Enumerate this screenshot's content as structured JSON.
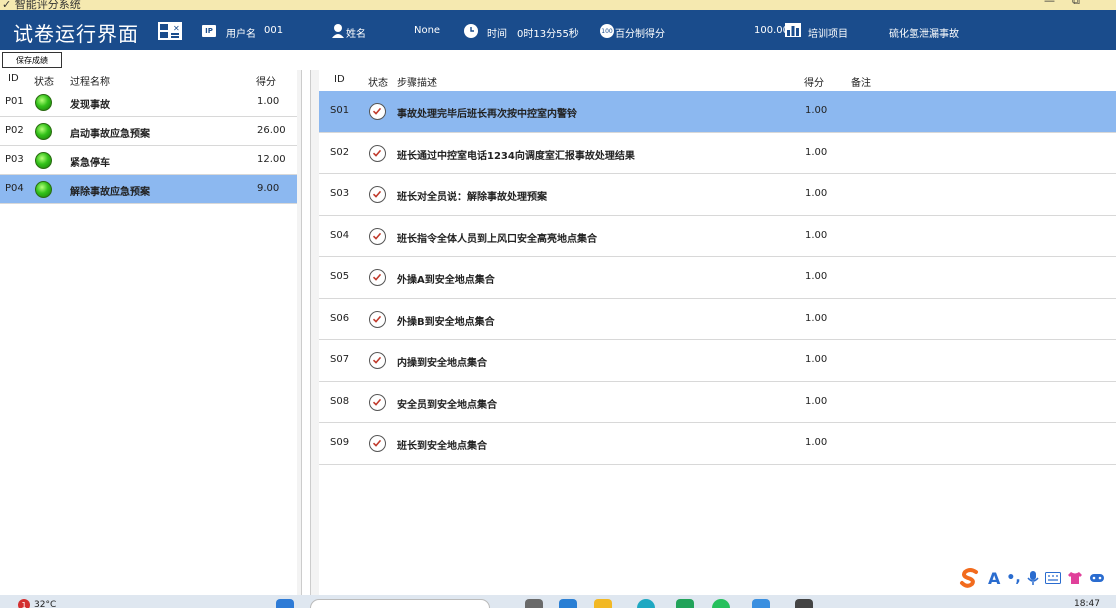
{
  "window": {
    "title": "智能评分系统"
  },
  "header": {
    "title": "试卷运行界面",
    "username_label": "用户名",
    "username_value": "001",
    "name_label": "姓名",
    "name_value": "None",
    "time_label": "时间",
    "time_value": "0时13分55秒",
    "score_label": "百分制得分",
    "score_value": "100.00",
    "project_label": "培训项目",
    "project_value": "硫化氢泄漏事故",
    "ip_icon_text": "IP",
    "score_icon_text": "100"
  },
  "toolbar": {
    "save_label": "保存成绩"
  },
  "left": {
    "columns": [
      "ID",
      "状态",
      "过程名称",
      "得分"
    ],
    "rows": [
      {
        "id": "P01",
        "name": "发现事故",
        "score": "1.00"
      },
      {
        "id": "P02",
        "name": "启动事故应急预案",
        "score": "26.00"
      },
      {
        "id": "P03",
        "name": "紧急停车",
        "score": "12.00"
      },
      {
        "id": "P04",
        "name": "解除事故应急预案",
        "score": "9.00"
      }
    ],
    "selected_index": 3
  },
  "right": {
    "columns": [
      "ID",
      "状态",
      "步骤描述",
      "得分",
      "备注"
    ],
    "rows": [
      {
        "id": "S01",
        "desc": "事故处理完毕后班长再次按中控室内警铃",
        "score": "1.00"
      },
      {
        "id": "S02",
        "desc": "班长通过中控室电话1234向调度室汇报事故处理结果",
        "score": "1.00"
      },
      {
        "id": "S03",
        "desc": "班长对全员说：解除事故处理预案",
        "score": "1.00"
      },
      {
        "id": "S04",
        "desc": "班长指令全体人员到上风口安全高亮地点集合",
        "score": "1.00"
      },
      {
        "id": "S05",
        "desc": "外操A到安全地点集合",
        "score": "1.00"
      },
      {
        "id": "S06",
        "desc": "外操B到安全地点集合",
        "score": "1.00"
      },
      {
        "id": "S07",
        "desc": "内操到安全地点集合",
        "score": "1.00"
      },
      {
        "id": "S08",
        "desc": "安全员到安全地点集合",
        "score": "1.00"
      },
      {
        "id": "S09",
        "desc": "班长到安全地点集合",
        "score": "1.00"
      }
    ],
    "selected_index": 0
  },
  "ime": {
    "mode": "A"
  },
  "taskbar": {
    "weather_badge": "1",
    "temperature": "32°C",
    "time": "18:47"
  },
  "colors": {
    "header_bg": "#1a4c8c",
    "selection": "#8cb8f0",
    "ime_orange": "#f26b1d"
  }
}
